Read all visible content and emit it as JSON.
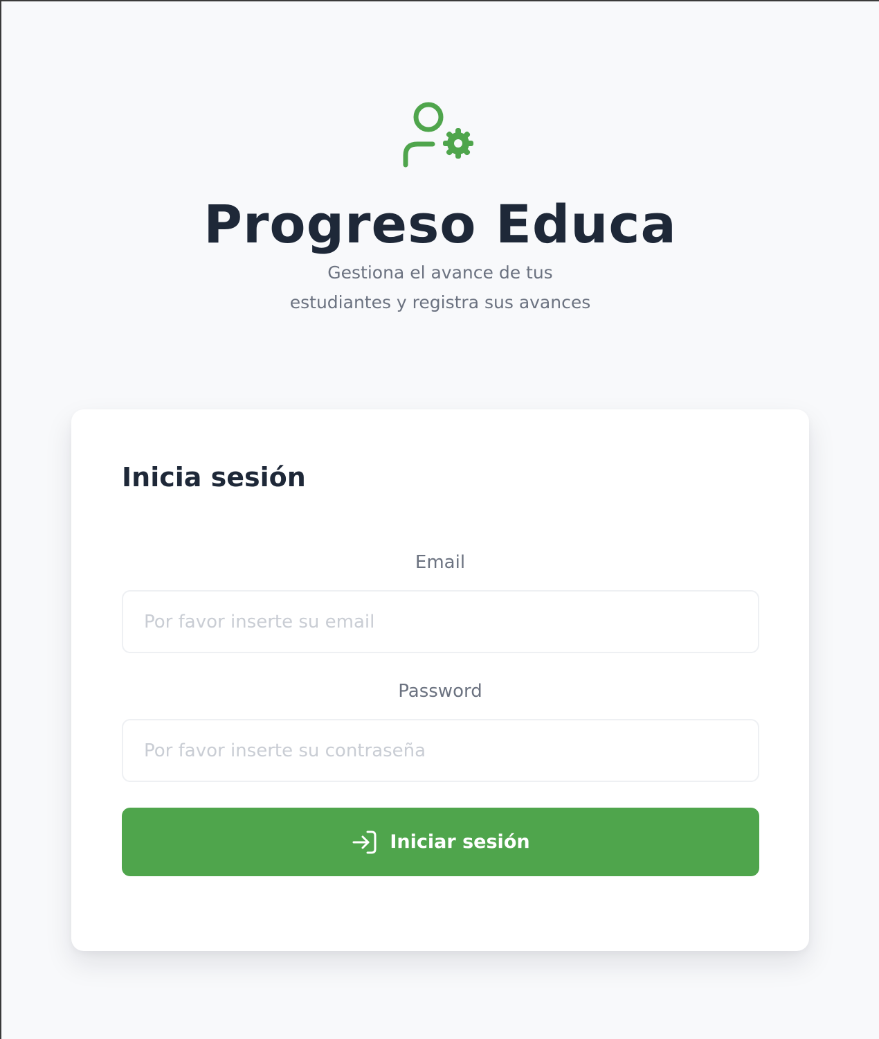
{
  "brand": {
    "title": "Progreso Educa",
    "subtitle": "Gestiona el avance de tus estudiantes y registra sus avances",
    "icon": "user-gear-icon",
    "accent_color": "#4fa54c"
  },
  "login_form": {
    "heading": "Inicia sesión",
    "email": {
      "label": "Email",
      "placeholder": "Por favor inserte su email",
      "value": ""
    },
    "password": {
      "label": "Password",
      "placeholder": "Por favor inserte su contraseña",
      "value": ""
    },
    "submit": {
      "label": "Iniciar sesión",
      "icon": "login-icon"
    }
  }
}
